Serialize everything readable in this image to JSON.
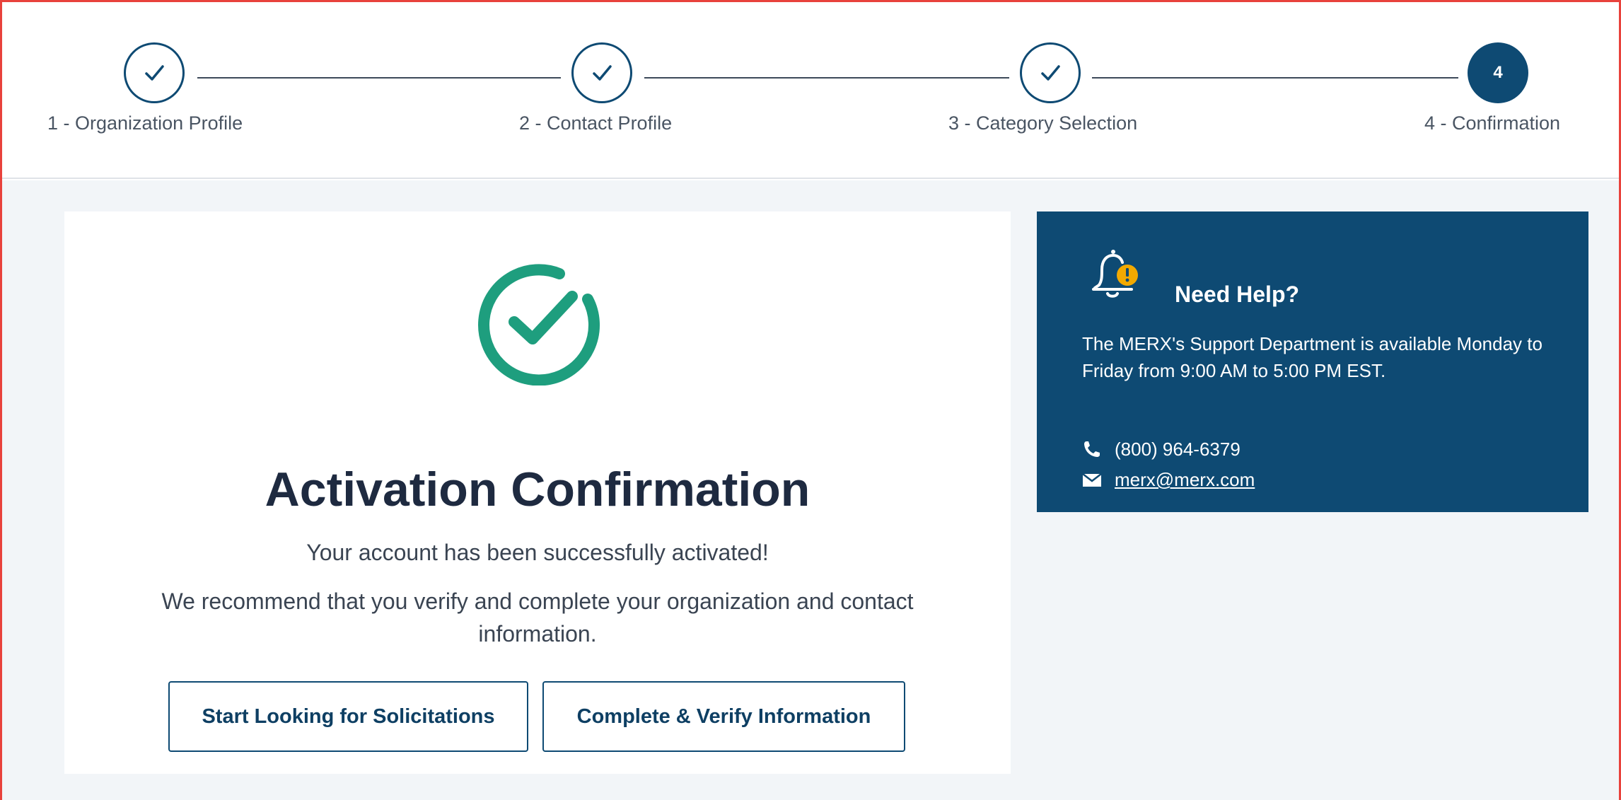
{
  "stepper": {
    "steps": [
      {
        "label": "1 - Organization Profile",
        "status": "completed"
      },
      {
        "label": "2 - Contact Profile",
        "status": "completed"
      },
      {
        "label": "3 - Category Selection",
        "status": "completed"
      },
      {
        "label": "4 - Confirmation",
        "status": "active",
        "number": "4"
      }
    ]
  },
  "confirmation": {
    "icon": "check-circle-icon",
    "title": "Activation Confirmation",
    "message": "Your account has been successfully activated!",
    "recommendation": "We recommend that you verify and complete your organization and contact information.",
    "start_button_label": "Start Looking for Solicitations",
    "verify_button_label": "Complete & Verify Information"
  },
  "help": {
    "icon": "bell-alert-icon",
    "title": "Need Help?",
    "text": "The MERX's Support Department is available Monday to Friday from 9:00 AM to 5:00 PM EST.",
    "phone": "(800) 964-6379",
    "email": "merx@merx.com"
  },
  "colors": {
    "primary": "#0e4a73",
    "success": "#1e9e7e",
    "warning": "#f2a900",
    "background": "#f2f5f8",
    "frame_border": "#e8423c"
  }
}
